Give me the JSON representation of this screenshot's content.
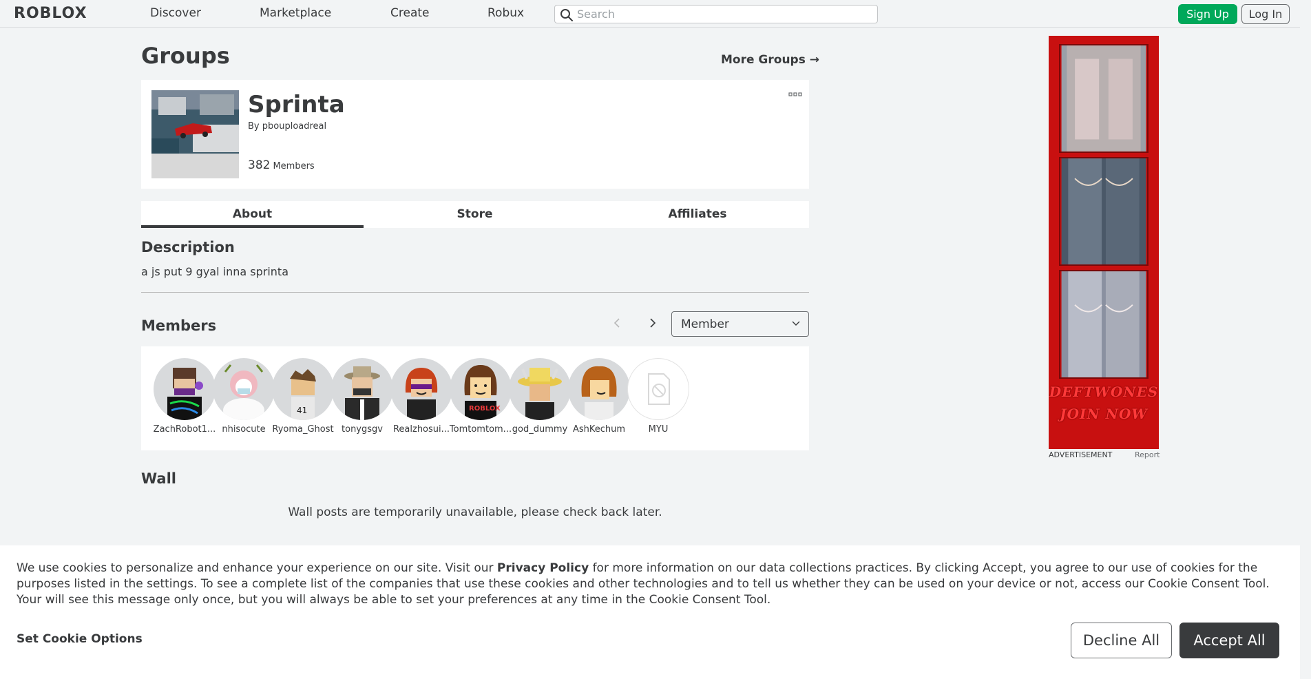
{
  "header": {
    "logo": "ROBLOX",
    "nav": [
      "Discover",
      "Marketplace",
      "Create",
      "Robux"
    ],
    "search_placeholder": "Search",
    "signup_label": "Sign Up",
    "login_label": "Log In"
  },
  "page": {
    "title": "Groups",
    "more_groups": "More Groups →"
  },
  "group": {
    "name": "Sprinta",
    "owner_prefix": "By",
    "owner": "pbouploadreal",
    "member_count": "382",
    "member_label": "Members"
  },
  "tabs": [
    "About",
    "Store",
    "Affiliates"
  ],
  "about": {
    "description_title": "Description",
    "description": "a js put 9 gyal inna sprinta"
  },
  "members": {
    "title": "Members",
    "role_select": "Member",
    "list": [
      {
        "name": "ZachRobot1...",
        "color": "#5a3a2a"
      },
      {
        "name": "nhisocute",
        "color": "#e8a0a8"
      },
      {
        "name": "Ryoma_Ghost",
        "color": "#6b4a2a"
      },
      {
        "name": "tonygsgv",
        "color": "#9a8a6a"
      },
      {
        "name": "Realzhosui...",
        "color": "#c8421a"
      },
      {
        "name": "Tomtomtom...",
        "color": "#6a3a1a"
      },
      {
        "name": "god_dummy",
        "color": "#e8c84a"
      },
      {
        "name": "AshKechum",
        "color": "#b8621a"
      },
      {
        "name": "MYU",
        "color": "#ffffff"
      }
    ]
  },
  "wall": {
    "title": "Wall",
    "message": "Wall posts are temporarily unavailable, please check back later."
  },
  "ad": {
    "text_line1": "DEFTWONES",
    "text_line2": "JOIN NOW",
    "label": "ADVERTISEMENT",
    "report": "Report"
  },
  "cookie": {
    "text_before": "We use cookies to personalize and enhance your experience on our site. Visit our ",
    "link": "Privacy Policy",
    "text_after": " for more information on our data collections practices. By clicking Accept, you agree to our use of cookies for the purposes listed in the settings. To see a complete list of the companies that use these cookies and other technologies and to tell us whether they can be used on your device or not, access our Cookie Consent Tool. Your will see this message only once, but you will always be able to set your preferences at any time in the Cookie Consent Tool.",
    "options_label": "Set Cookie Options",
    "decline_label": "Decline All",
    "accept_label": "Accept All"
  }
}
